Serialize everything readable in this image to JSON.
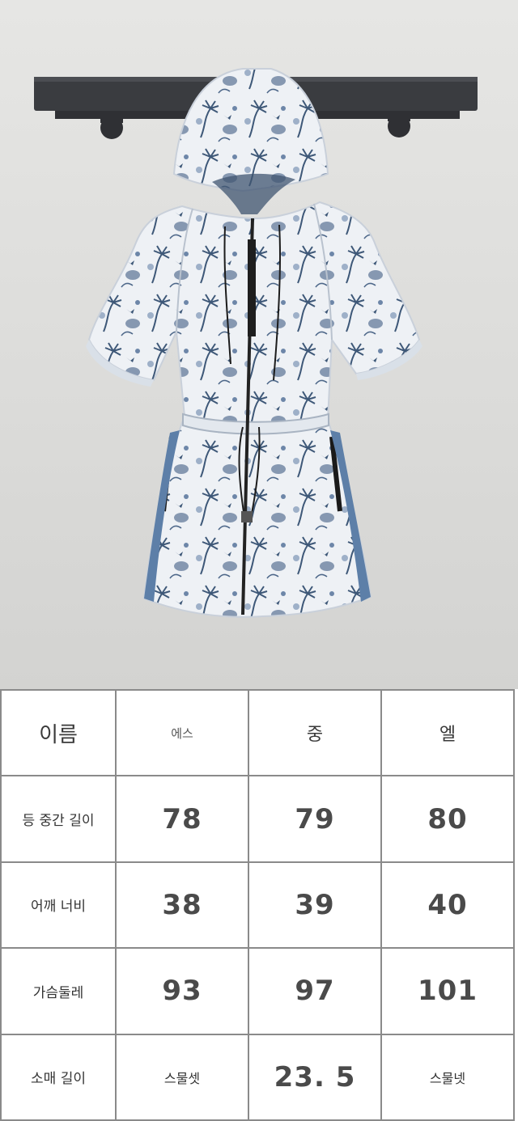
{
  "size_table": {
    "header": [
      "이름",
      "에스",
      "중",
      "엘"
    ],
    "rows": [
      {
        "label": "등 중간 길이",
        "values": [
          "78",
          "79",
          "80"
        ]
      },
      {
        "label": "어깨 너비",
        "values": [
          "38",
          "39",
          "40"
        ]
      },
      {
        "label": "가슴둘레",
        "values": [
          "93",
          "97",
          "101"
        ]
      },
      {
        "label": "소매 길이",
        "values": [
          "스물셋",
          "23. 5",
          "스물넷"
        ]
      }
    ]
  },
  "colors": {
    "fabric": "#f2f4f7",
    "print": "#3e5878",
    "side_stripe": "#5d7fa8",
    "rack": "#3a3c40",
    "table_border": "#8a8a8a"
  }
}
